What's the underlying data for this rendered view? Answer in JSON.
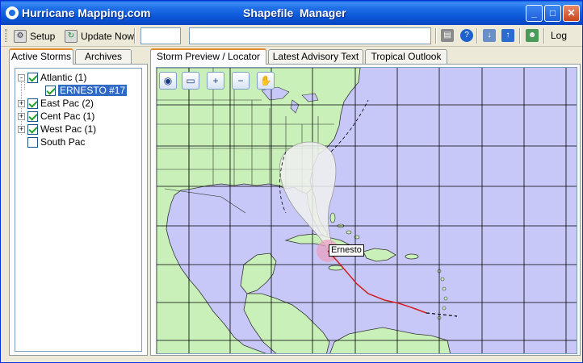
{
  "window": {
    "app_title": "Hurricane Mapping.com",
    "title": "Shapefile  Manager",
    "controls": {
      "minimize": "_",
      "maximize": "□",
      "close": "✕"
    }
  },
  "toolbar": {
    "setup_label": "Setup",
    "update_label": "Update Now",
    "field_a_value": "",
    "field_b_value": "",
    "log_label": "Log",
    "icons": [
      "settings-icon",
      "refresh-icon",
      "print-icon",
      "help-icon",
      "download-icon",
      "upload-icon",
      "user-icon"
    ]
  },
  "left_tabs": [
    {
      "label": "Active Storms",
      "active": true
    },
    {
      "label": "Archives",
      "active": false
    }
  ],
  "tree": [
    {
      "label": "Atlantic (1)",
      "checked": true,
      "expander": "-"
    },
    {
      "label": "ERNESTO #17",
      "checked": true,
      "selected": true
    },
    {
      "label": "East Pac (2)",
      "checked": true,
      "expander": "+"
    },
    {
      "label": "Cent Pac (1)",
      "checked": true,
      "expander": "+"
    },
    {
      "label": "West Pac (1)",
      "checked": true,
      "expander": "+"
    },
    {
      "label": "South Pac",
      "checked": false
    }
  ],
  "right_tabs": [
    {
      "label": "Storm Preview / Locator",
      "active": true
    },
    {
      "label": "Latest Advisory Text",
      "active": false
    },
    {
      "label": "Tropical Outlook",
      "active": false
    }
  ],
  "map": {
    "storm_name": "Ernesto",
    "tools": [
      "globe-icon",
      "zoom-rect-icon",
      "zoom-in-icon",
      "zoom-out-icon",
      "pan-hand-icon"
    ],
    "colors": {
      "ocean": "#c8c8f8",
      "land": "#c8f0b8",
      "cone": "#f0f0f0",
      "storm_circle": "#e8a0c0",
      "track": "#d02020"
    }
  }
}
